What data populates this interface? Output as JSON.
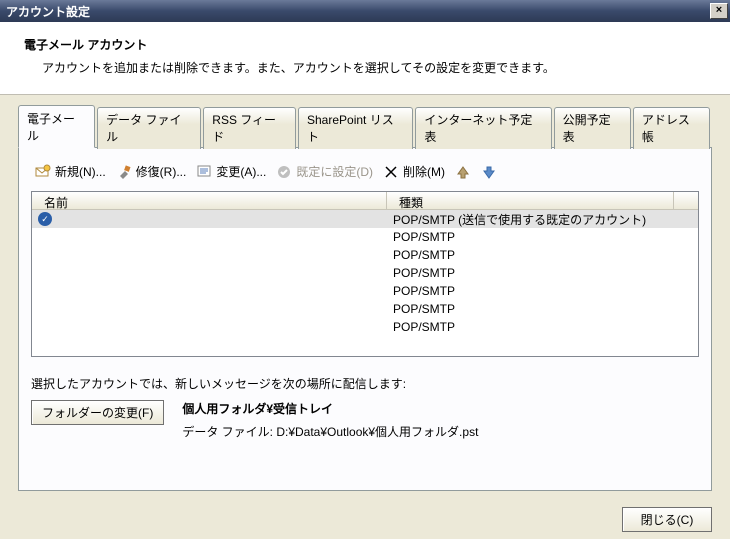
{
  "window": {
    "title": "アカウント設定",
    "close_glyph": "×"
  },
  "header": {
    "title": "電子メール アカウント",
    "description": "アカウントを追加または削除できます。また、アカウントを選択してその設定を変更できます。"
  },
  "tabs": [
    {
      "label": "電子メール",
      "active": true
    },
    {
      "label": "データ ファイル"
    },
    {
      "label": "RSS フィード"
    },
    {
      "label": "SharePoint リスト"
    },
    {
      "label": "インターネット予定表"
    },
    {
      "label": "公開予定表"
    },
    {
      "label": "アドレス帳"
    }
  ],
  "toolbar": {
    "new": "新規(N)...",
    "repair": "修復(R)...",
    "change": "変更(A)...",
    "set_default": "既定に設定(D)",
    "delete": "削除(M)"
  },
  "list": {
    "col_name": "名前",
    "col_type": "種類",
    "rows": [
      {
        "name": "",
        "type": "POP/SMTP (送信で使用する既定のアカウント)",
        "default": true,
        "selected": true
      },
      {
        "name": "",
        "type": "POP/SMTP"
      },
      {
        "name": "",
        "type": "POP/SMTP"
      },
      {
        "name": "",
        "type": "POP/SMTP"
      },
      {
        "name": "",
        "type": "POP/SMTP"
      },
      {
        "name": "",
        "type": "POP/SMTP"
      },
      {
        "name": "",
        "type": "POP/SMTP"
      }
    ]
  },
  "delivery": {
    "intro": "選択したアカウントでは、新しいメッセージを次の場所に配信します:",
    "change_folder_btn": "フォルダーの変更(F)",
    "location": "個人用フォルダ¥受信トレイ",
    "datafile_label": "データ ファイル: D:¥Data¥Outlook¥個人用フォルダ.pst"
  },
  "footer": {
    "close_btn": "閉じる(C)"
  },
  "colors": {
    "titlebar_grad_top": "#6b7a99",
    "titlebar_grad_bottom": "#2d3a55",
    "panel_bg": "#ece9d8",
    "selected_row_bg": "#e3e3e3",
    "default_badge_bg": "#2a5ea8"
  }
}
